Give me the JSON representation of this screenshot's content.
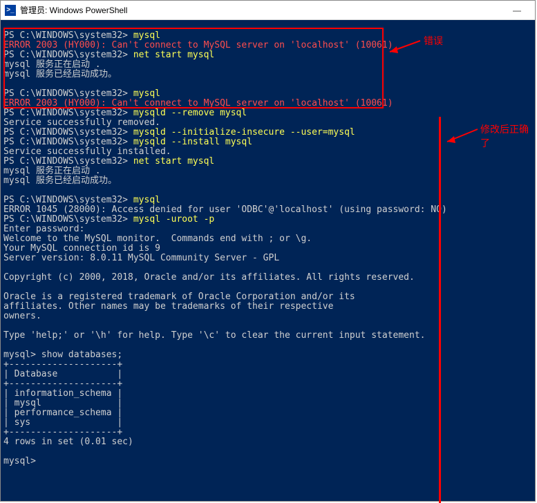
{
  "window": {
    "title": "管理员: Windows PowerShell",
    "iconGlyph": ">_"
  },
  "controls": {
    "minimize": "—"
  },
  "anno": {
    "err": "错误",
    "ok": "修改后正确了"
  },
  "term": {
    "l01p": "PS C:\\WINDOWS\\system32> ",
    "l01c": "mysql",
    "l02": "ERROR 2003 (HY000): Can't connect to MySQL server on 'localhost' (10061)",
    "l03p": "PS C:\\WINDOWS\\system32> ",
    "l03c": "net start mysql",
    "l04": "mysql 服务正在启动 .",
    "l05": "mysql 服务已经启动成功。",
    "l06": "",
    "l07p": "PS C:\\WINDOWS\\system32> ",
    "l07c": "mysql",
    "l08": "ERROR 2003 (HY000): Can't connect to MySQL server on 'localhost' (10061)",
    "l09p": "PS C:\\WINDOWS\\system32> ",
    "l09c": "mysqld --remove mysql",
    "l10": "Service successfully removed.",
    "l11p": "PS C:\\WINDOWS\\system32> ",
    "l11c": "mysqld --initialize-insecure --user=mysql",
    "l12p": "PS C:\\WINDOWS\\system32> ",
    "l12c": "mysqld --install mysql",
    "l13": "Service successfully installed.",
    "l14p": "PS C:\\WINDOWS\\system32> ",
    "l14c": "net start mysql",
    "l15": "mysql 服务正在启动 .",
    "l16": "mysql 服务已经启动成功。",
    "l17": "",
    "l18p": "PS C:\\WINDOWS\\system32> ",
    "l18c": "mysql",
    "l19": "ERROR 1045 (28000): Access denied for user 'ODBC'@'localhost' (using password: NO)",
    "l20p": "PS C:\\WINDOWS\\system32> ",
    "l20c": "mysql -uroot -p",
    "l21": "Enter password:",
    "l22": "Welcome to the MySQL monitor.  Commands end with ; or \\g.",
    "l23": "Your MySQL connection id is 9",
    "l24": "Server version: 8.0.11 MySQL Community Server - GPL",
    "l25": "",
    "l26": "Copyright (c) 2000, 2018, Oracle and/or its affiliates. All rights reserved.",
    "l27": "",
    "l28": "Oracle is a registered trademark of Oracle Corporation and/or its",
    "l29": "affiliates. Other names may be trademarks of their respective",
    "l30": "owners.",
    "l31": "",
    "l32": "Type 'help;' or '\\h' for help. Type '\\c' to clear the current input statement.",
    "l33": "",
    "l34": "mysql> show databases;",
    "l35": "+--------------------+",
    "l36": "| Database           |",
    "l37": "+--------------------+",
    "l38": "| information_schema |",
    "l39": "| mysql              |",
    "l40": "| performance_schema |",
    "l41": "| sys                |",
    "l42": "+--------------------+",
    "l43": "4 rows in set (0.01 sec)",
    "l44": "",
    "l45": "mysql>"
  }
}
